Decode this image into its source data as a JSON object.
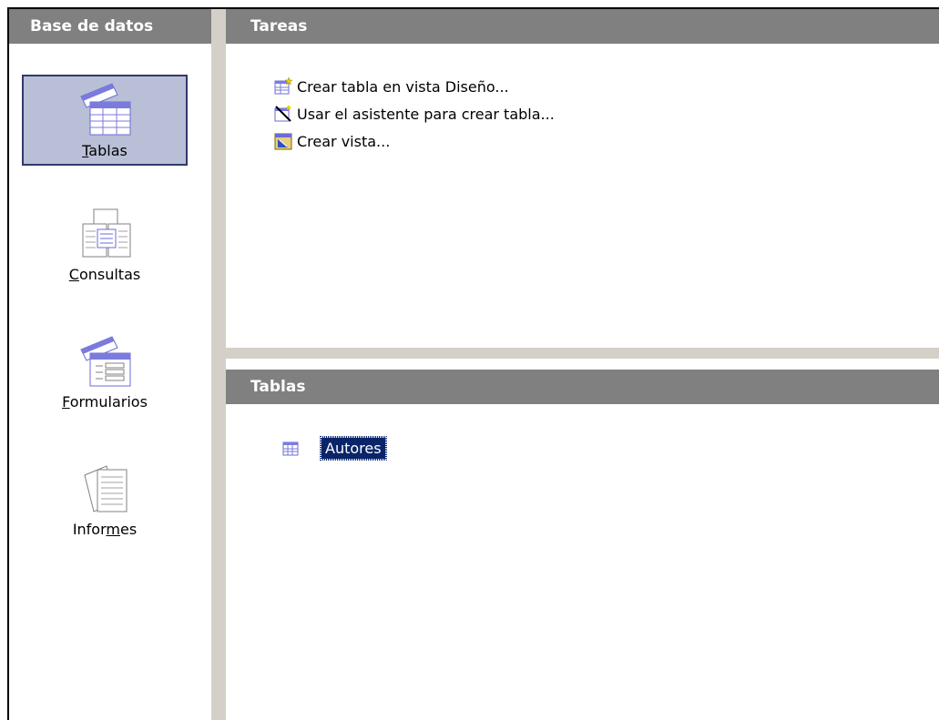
{
  "sidebar": {
    "title": "Base de datos",
    "items": [
      {
        "label": "Tablas",
        "mnemonic": "T",
        "rest": "ablas",
        "selected": true,
        "icon": "tables-icon"
      },
      {
        "label": "Consultas",
        "mnemonic": "C",
        "rest": "onsultas",
        "selected": false,
        "icon": "queries-icon"
      },
      {
        "label": "Formularios",
        "mnemonic": "F",
        "rest": "ormularios",
        "selected": false,
        "icon": "forms-icon"
      },
      {
        "label": "Informes",
        "pre": "Infor",
        "mnemonic": "m",
        "rest": "es",
        "selected": false,
        "icon": "reports-icon"
      }
    ]
  },
  "tasks": {
    "title": "Tareas",
    "items": [
      {
        "label": "Crear tabla en vista Diseño...",
        "icon": "design-table-icon"
      },
      {
        "label": "Usar el asistente para crear tabla...",
        "icon": "table-wizard-icon"
      },
      {
        "label": "Crear vista...",
        "icon": "create-view-icon"
      }
    ]
  },
  "tables": {
    "title": "Tablas",
    "items": [
      {
        "label": "Autores",
        "selected": true,
        "icon": "table-icon"
      }
    ]
  },
  "colors": {
    "header_bg": "#808080",
    "splitter": "#d4d0c8",
    "selection_bg": "#0a246a",
    "category_selected_bg": "#b9bfd6"
  }
}
